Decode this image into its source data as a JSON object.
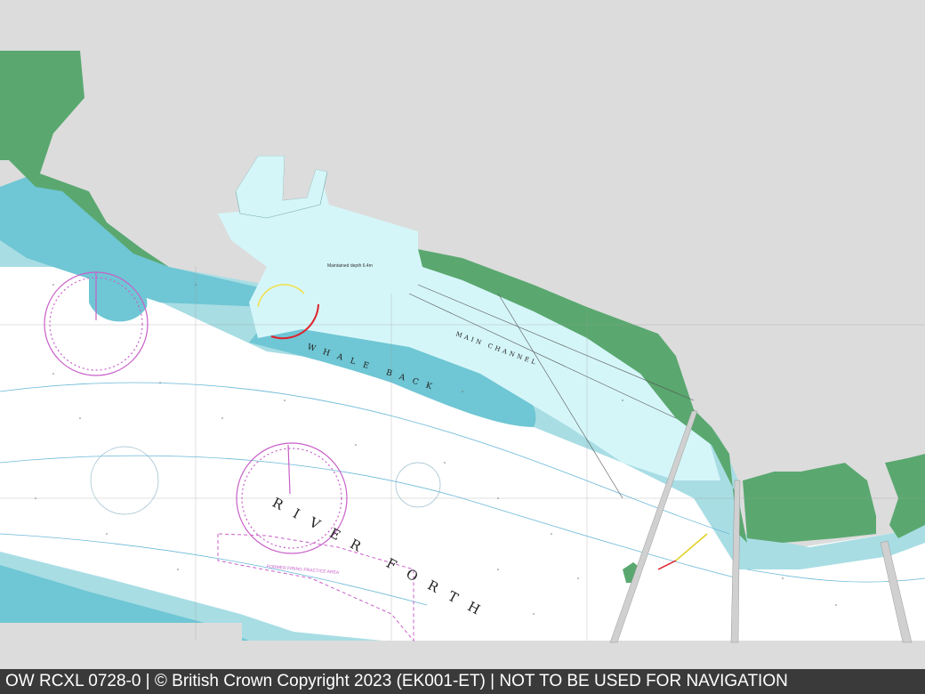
{
  "footer": {
    "text": "OW RCXL 0728-0 | © British Crown Copyright 2023 (EK001-ET) | NOT TO BE USED FOR NAVIGATION"
  },
  "labels": {
    "river": "RIVER FORTH",
    "bank": "WHALE BACK",
    "channel": "MAIN CHANNEL",
    "practice_area": "FORMER FIRING PRACTICE AREA",
    "maintained_depth": "Maintained depth 6.4m"
  },
  "colors": {
    "land": "#5aa870",
    "deep_water": "#ffffff",
    "shallow_water": "#a8dde4",
    "very_shallow": "#6fc6d4",
    "dredged": "#d5f6f9",
    "no_data": "#dcdcdc",
    "footer_bg": "#3a3a3a"
  }
}
